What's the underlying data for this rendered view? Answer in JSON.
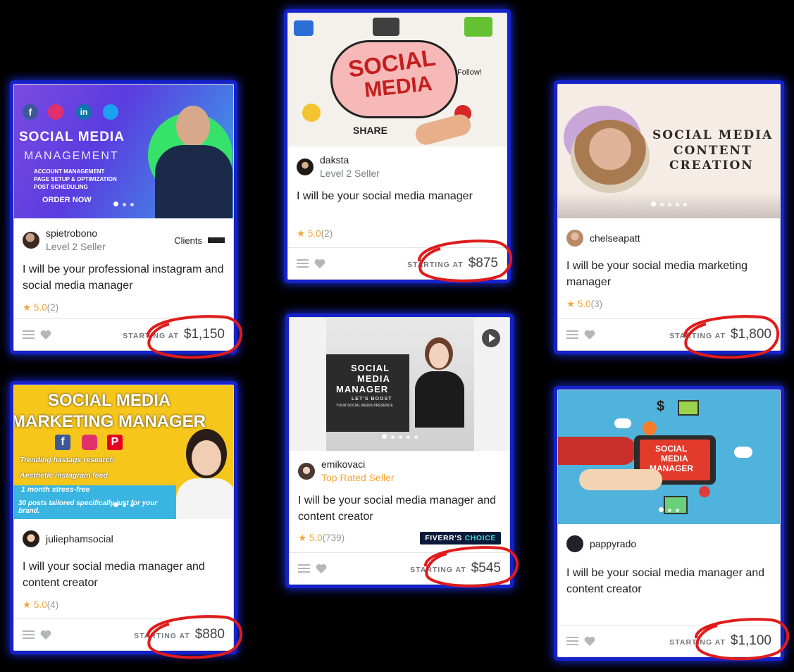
{
  "cards": [
    {
      "seller": "spietrobono",
      "level": "Level 2 Seller",
      "clients": "Clients",
      "title": "I will be your professional instagram and social media manager",
      "rating": "5.0",
      "reviews": "(2)",
      "starting": "STARTING AT",
      "price": "$1,150",
      "thumb": {
        "line1": "SOCIAL MEDIA",
        "line2": "MANAGEMENT",
        "bullets": [
          "ACCOUNT MANAGEMENT",
          "PAGE SETUP & OPTIMIZATION",
          "POST SCHEDULING"
        ],
        "cta": "ORDER NOW"
      }
    },
    {
      "seller": "daksta",
      "level": "Level 2 Seller",
      "title": "I will be your social media manager",
      "rating": "5.0",
      "reviews": "(2)",
      "starting": "STARTING AT",
      "price": "$875",
      "thumb": {
        "line1": "SOCIAL",
        "line2": "MEDIA",
        "extra1": "SHARE",
        "extra2": "Follow!"
      }
    },
    {
      "seller": "chelseapatt",
      "title": "I will be your social media marketing manager",
      "rating": "5.0",
      "reviews": "(3)",
      "starting": "STARTING AT",
      "price": "$1,800",
      "thumb": {
        "line1": "SOCIAL MEDIA",
        "line2": "CONTENT",
        "line3": "CREATION"
      }
    },
    {
      "seller": "juliephamsocial",
      "title": "I will your social media manager and content creator",
      "rating": "5.0",
      "reviews": "(4)",
      "starting": "STARTING AT",
      "price": "$880",
      "thumb": {
        "line1": "SOCIAL MEDIA",
        "line2": "MARKETING MANAGER",
        "bullets": [
          "Trending hastags research",
          "Aesthetic instagram feed",
          "1 month stress-free",
          "30 posts tailored specifically just for your brand."
        ]
      }
    },
    {
      "seller": "emikovaci",
      "level": "Top Rated Seller",
      "title": "I will be your social media manager and content creator",
      "rating": "5.0",
      "reviews": "(739)",
      "starting": "STARTING AT",
      "price": "$545",
      "badge_a": "FIVERR'S",
      "badge_b": "CHOICE",
      "thumb": {
        "line1": "SOCIAL",
        "line2": "MEDIA",
        "line3": "MANAGER",
        "sub": "LET'S BOOST",
        "sub2": "YOUR SOCIAL MEDIA PRESENCE"
      }
    },
    {
      "seller": "pappyrado",
      "title": "I will be your social media manager and content creator",
      "starting": "STARTING AT",
      "price": "$1,100",
      "thumb": {
        "line1": "SOCIAL",
        "line2": "MEDIA",
        "line3": "MANAGER"
      }
    }
  ]
}
